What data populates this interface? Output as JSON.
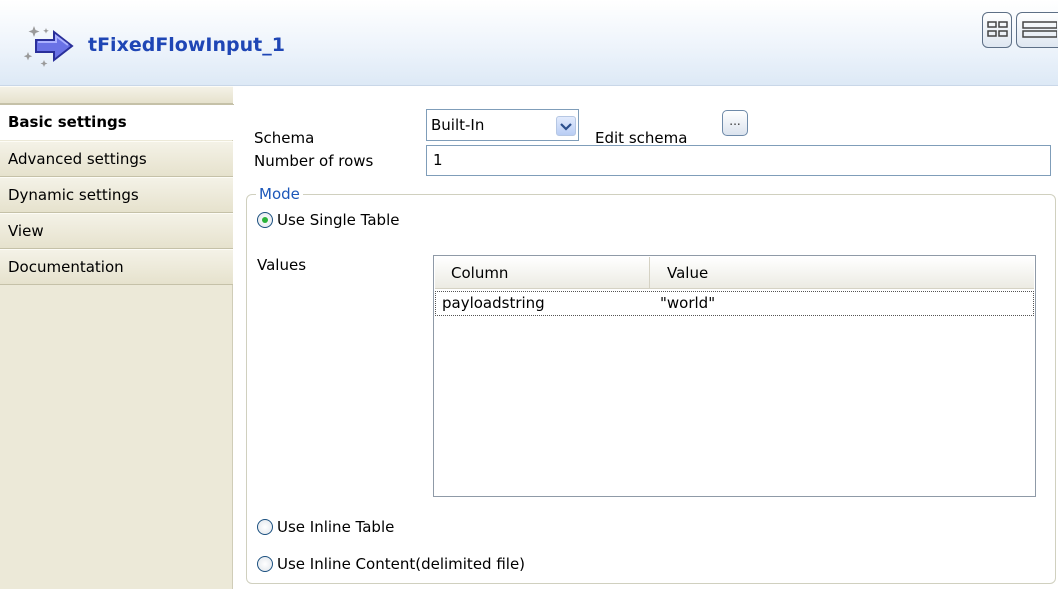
{
  "header": {
    "title": "tFixedFlowInput_1",
    "icon": "component-arrow-icon",
    "accent_color": "#1f46b5"
  },
  "sidebar": {
    "tabs": [
      {
        "label": "Basic settings",
        "active": true
      },
      {
        "label": "Advanced settings",
        "active": false
      },
      {
        "label": "Dynamic settings",
        "active": false
      },
      {
        "label": "View",
        "active": false
      },
      {
        "label": "Documentation",
        "active": false
      }
    ]
  },
  "form": {
    "schema_label": "Schema",
    "schema_value": "Built-In",
    "edit_schema_label": "Edit schema",
    "edit_schema_button": "...",
    "rows_label": "Number of rows",
    "rows_value": "1"
  },
  "mode": {
    "legend": "Mode",
    "options": [
      {
        "label": "Use Single Table",
        "selected": true
      },
      {
        "label": "Use Inline Table",
        "selected": false
      },
      {
        "label": "Use Inline Content(delimited file)",
        "selected": false
      }
    ],
    "values_label": "Values"
  },
  "values_table": {
    "columns": [
      "Column",
      "Value"
    ],
    "rows": [
      [
        "payloadstring",
        "\"world\""
      ]
    ]
  }
}
